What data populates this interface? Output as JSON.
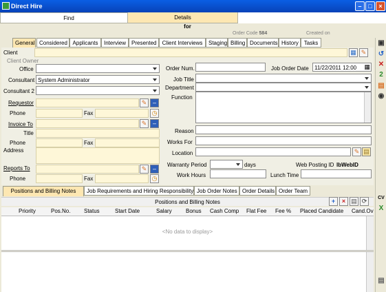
{
  "window": {
    "title": "Direct Hire"
  },
  "top_tabs": {
    "find": "Find",
    "details": "Details"
  },
  "header": {
    "for_label": "for",
    "order_code_label": "Order Code",
    "order_code_value": "584",
    "created_on_label": "Created on"
  },
  "tabs": [
    "General",
    "Considered",
    "Applicants",
    "Interview",
    "Presented",
    "Client Interviews",
    "Staging",
    "Billing",
    "Documents",
    "History",
    "Tasks"
  ],
  "left": {
    "client_label": "Client",
    "client_owner_label": "Client Owner",
    "office_label": "Office",
    "consultant_label": "Consultant",
    "consultant_value": "System Administrator",
    "consultant2_label": "Consultant 2",
    "requestor_label": "Requestor",
    "phone_label": "Phone",
    "fax_label": "Fax",
    "invoice_to_label": "Invoice To",
    "title_label": "Title",
    "address_label": "Address",
    "reports_to_label": "Reports To"
  },
  "right": {
    "order_num_label": "Order Num.",
    "job_order_date_label": "Job Order Date",
    "job_order_date_value": "11/22/2011 12:00",
    "job_title_label": "Job Title",
    "department_label": "Department",
    "function_label": "Function",
    "reason_label": "Reason",
    "works_for_label": "Works For",
    "location_label": "Location",
    "warranty_period_label": "Warranty Period",
    "days_label": "days",
    "web_posting_label": "Web Posting ID",
    "web_posting_value": "lbWebID",
    "work_hours_label": "Work Hours",
    "lunch_time_label": "Lunch Time"
  },
  "bottom_tabs": [
    "Positions and Billing Notes",
    "Job Requirements and Hiring Responsibility",
    "Job Order Notes",
    "Order Details",
    "Order Team"
  ],
  "grid": {
    "title": "Positions and Billing Notes",
    "columns": [
      "Priority",
      "Pos.No.",
      "Status",
      "Start Date",
      "Salary",
      "Bonus",
      "Cash Comp",
      "Flat Fee",
      "Fee %",
      "Placed Candidate",
      "Cand.Ov"
    ],
    "empty_text": "<No data to display>"
  },
  "sidebar": {
    "cv_label": "CV"
  },
  "colors": {
    "title_bar": "#0a5fe4",
    "active_tab": "#fde7b2",
    "field_yellow": "#fef7d8"
  }
}
